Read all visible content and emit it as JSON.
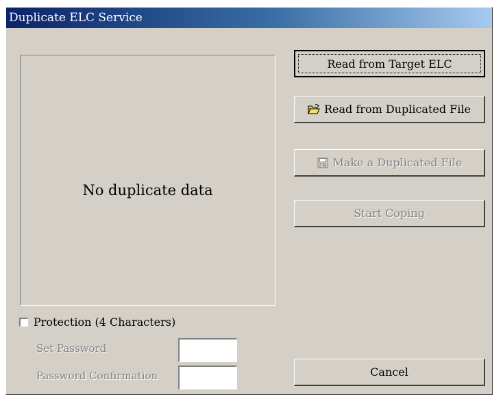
{
  "window": {
    "title": "Duplicate ELC Service"
  },
  "preview": {
    "message": "No duplicate data"
  },
  "buttons": {
    "read_target": "Read from Target ELC",
    "read_file": "Read from Duplicated File",
    "make_file": "Make a Duplicated File",
    "start_copying": "Start Coping",
    "cancel": "Cancel"
  },
  "protection": {
    "label": "Protection (4 Characters)",
    "checked": false,
    "set_password_label": "Set Password",
    "set_password_value": "",
    "confirm_label": "Password Confirmation",
    "confirm_value": ""
  },
  "icons": {
    "open_folder": "open-folder-icon",
    "save": "floppy-disk-icon"
  },
  "colors": {
    "face": "#d4d0c8",
    "titlebar_start": "#0a246a",
    "titlebar_end": "#a6caf0",
    "disabled_text": "#808080"
  }
}
